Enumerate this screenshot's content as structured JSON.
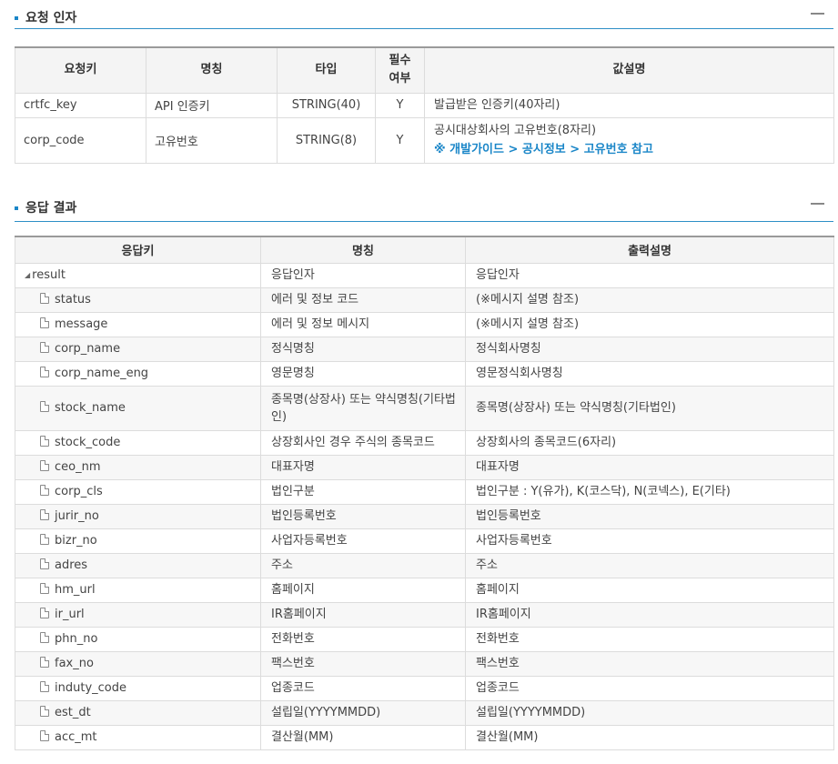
{
  "request_section": {
    "title": "요청 인자",
    "headers": [
      "요청키",
      "명칭",
      "타입",
      "필수\n여부",
      "값설명"
    ],
    "rows": [
      {
        "key": "crtfc_key",
        "name": "API 인증키",
        "type": "STRING(40)",
        "required": "Y",
        "desc": "발급받은 인증키(40자리)"
      },
      {
        "key": "corp_code",
        "name": "고유번호",
        "type": "STRING(8)",
        "required": "Y",
        "desc": "공시대상회사의 고유번호(8자리)",
        "link": "※ 개발가이드 > 공시정보 > 고유번호 참고"
      }
    ]
  },
  "response_section": {
    "title": "응답 결과",
    "headers": [
      "응답키",
      "명칭",
      "출력설명"
    ],
    "root": {
      "key": "result",
      "name": "응답인자",
      "desc": "응답인자"
    },
    "rows": [
      {
        "key": "status",
        "name": "에러 및 정보 코드",
        "desc": "(※메시지 설명 참조)"
      },
      {
        "key": "message",
        "name": "에러 및 정보 메시지",
        "desc": "(※메시지 설명 참조)"
      },
      {
        "key": "corp_name",
        "name": "정식명칭",
        "desc": "정식회사명칭"
      },
      {
        "key": "corp_name_eng",
        "name": "영문명칭",
        "desc": "영문정식회사명칭"
      },
      {
        "key": "stock_name",
        "name": "종목명(상장사) 또는 약식명칭(기타법인)",
        "desc": "종목명(상장사) 또는 약식명칭(기타법인)"
      },
      {
        "key": "stock_code",
        "name": "상장회사인 경우 주식의 종목코드",
        "desc": "상장회사의 종목코드(6자리)"
      },
      {
        "key": "ceo_nm",
        "name": "대표자명",
        "desc": "대표자명"
      },
      {
        "key": "corp_cls",
        "name": "법인구분",
        "desc": "법인구분 : Y(유가), K(코스닥), N(코넥스), E(기타)"
      },
      {
        "key": "jurir_no",
        "name": "법인등록번호",
        "desc": "법인등록번호"
      },
      {
        "key": "bizr_no",
        "name": "사업자등록번호",
        "desc": "사업자등록번호"
      },
      {
        "key": "adres",
        "name": "주소",
        "desc": "주소"
      },
      {
        "key": "hm_url",
        "name": "홈페이지",
        "desc": "홈페이지"
      },
      {
        "key": "ir_url",
        "name": "IR홈페이지",
        "desc": "IR홈페이지"
      },
      {
        "key": "phn_no",
        "name": "전화번호",
        "desc": "전화번호"
      },
      {
        "key": "fax_no",
        "name": "팩스번호",
        "desc": "팩스번호"
      },
      {
        "key": "induty_code",
        "name": "업종코드",
        "desc": "업종코드"
      },
      {
        "key": "est_dt",
        "name": "설립일(YYYYMMDD)",
        "desc": "설립일(YYYYMMDD)"
      },
      {
        "key": "acc_mt",
        "name": "결산월(MM)",
        "desc": "결산월(MM)"
      }
    ]
  },
  "icons": {
    "collapse": "minus-icon",
    "tree_toggle": "triangle-down-icon",
    "leaf": "document-icon"
  },
  "colors": {
    "accent": "#1a86c8",
    "header_bg": "#f4f4f4",
    "border": "#dcdcdc"
  }
}
